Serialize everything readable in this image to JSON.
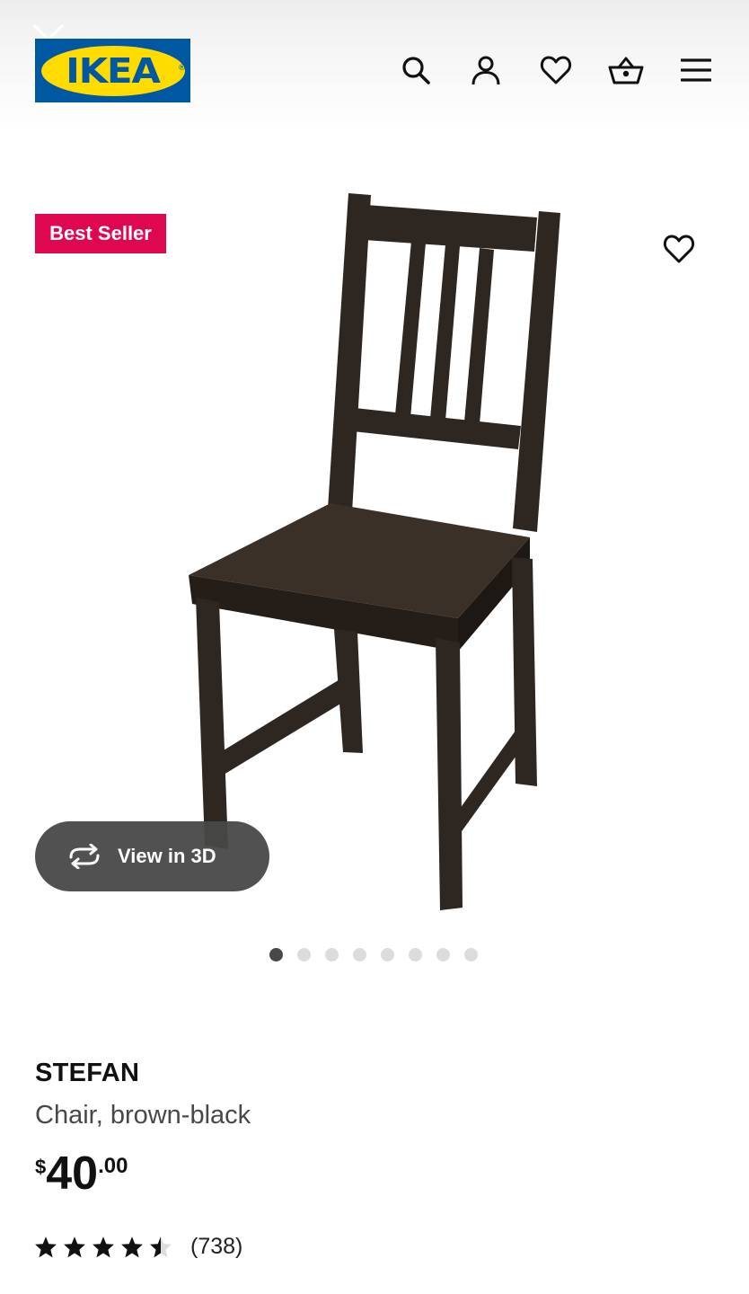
{
  "header": {
    "logo_text": "IKEA",
    "icons": [
      "close-icon",
      "search-icon",
      "account-icon",
      "heart-icon",
      "cart-icon",
      "menu-icon"
    ]
  },
  "hero": {
    "badge": "Best Seller",
    "view_3d_label": "View in 3D",
    "carousel_total": 8,
    "carousel_active": 1
  },
  "product": {
    "name": "STEFAN",
    "description": "Chair, brown-black",
    "price": {
      "currency": "$",
      "integer": "40",
      "decimal": ".00"
    },
    "rating": {
      "value": 4.5,
      "max": 5,
      "count_text": "(738)"
    }
  },
  "colors": {
    "ikea_blue": "#0058A3",
    "ikea_yellow": "#FFDB00",
    "badge_red": "#E00751",
    "chair_brown": "#2e2620"
  }
}
